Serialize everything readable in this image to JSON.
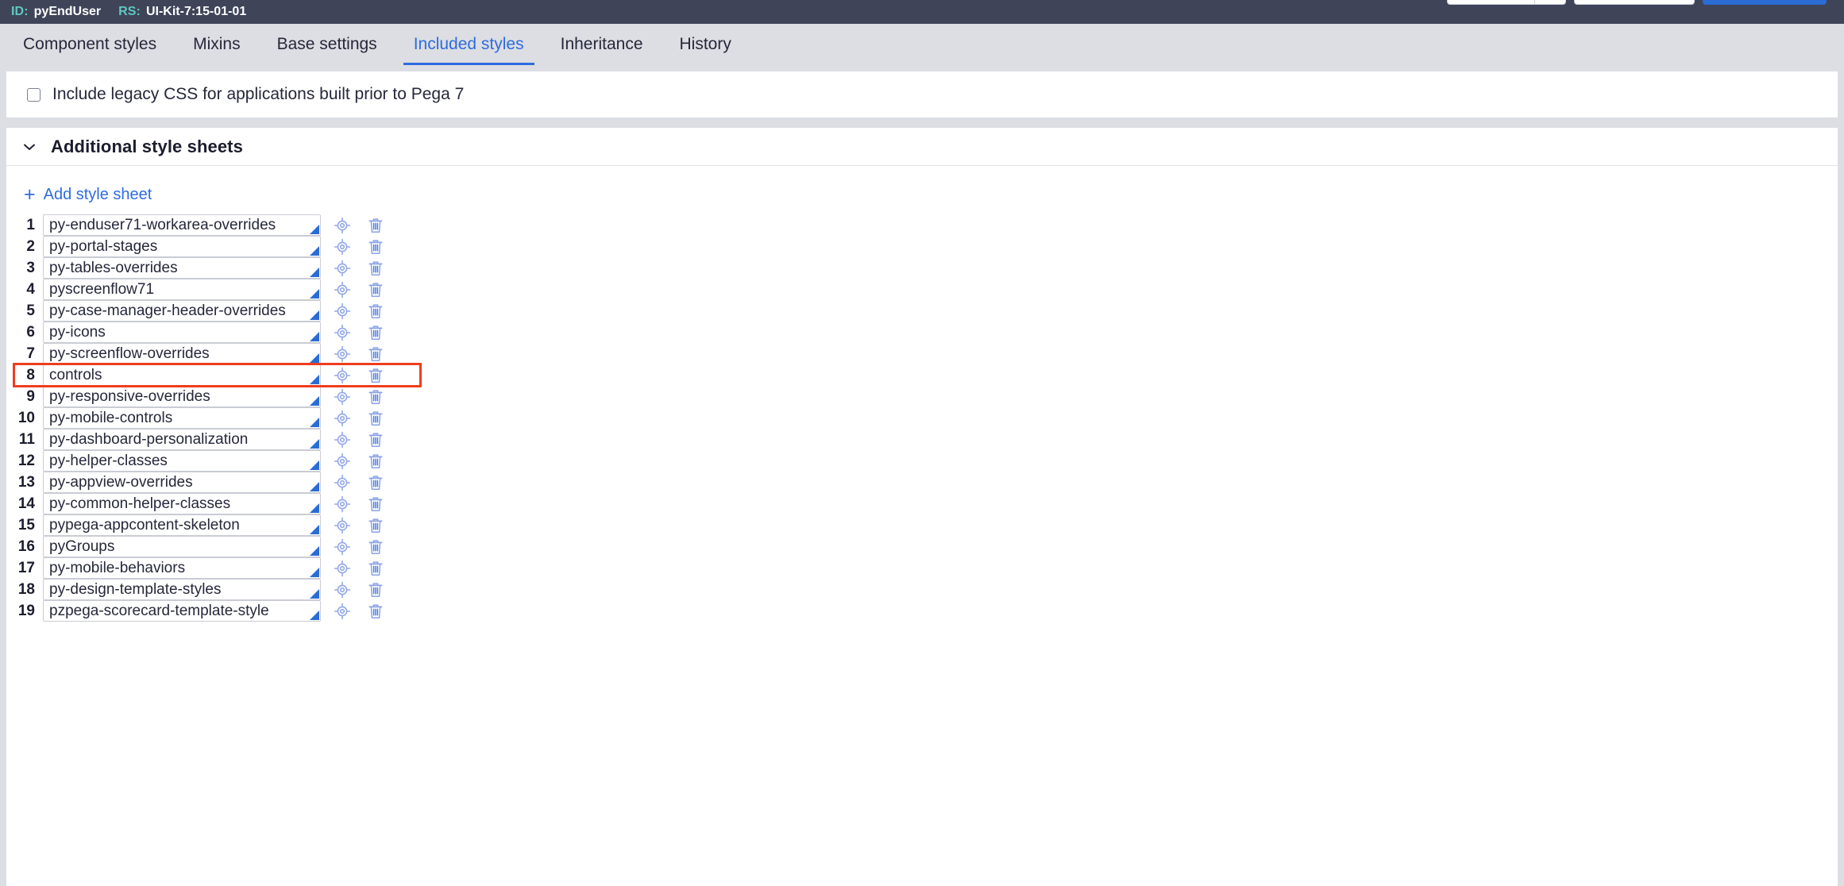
{
  "topbar": {
    "id_label": "ID:",
    "id_value": "pyEndUser",
    "rs_label": "RS:",
    "rs_value": "UI-Kit-7:15-01-01",
    "buttons": [
      {
        "name": "save-split-button",
        "label": ""
      },
      {
        "name": "secondary-action-button",
        "label": ""
      },
      {
        "name": "primary-action-button",
        "label": ""
      }
    ]
  },
  "tabs": [
    {
      "label": "Component styles",
      "active": false
    },
    {
      "label": "Mixins",
      "active": false
    },
    {
      "label": "Base settings",
      "active": false
    },
    {
      "label": "Included styles",
      "active": true
    },
    {
      "label": "Inheritance",
      "active": false
    },
    {
      "label": "History",
      "active": false
    }
  ],
  "legacy": {
    "checked": false,
    "label": "Include legacy CSS for applications built prior to Pega 7"
  },
  "sheets_section": {
    "title": "Additional style sheets",
    "collapse_icon": "chevron-down-icon",
    "add_label": "Add style sheet",
    "add_icon": "plus-icon",
    "row_icons": {
      "locate": "crosshair-icon",
      "delete": "trash-icon"
    },
    "grip_icon": "resize-grip-icon"
  },
  "style_sheets": [
    {
      "index": "1",
      "name": "py-enduser71-workarea-overrides"
    },
    {
      "index": "2",
      "name": "py-portal-stages"
    },
    {
      "index": "3",
      "name": "py-tables-overrides"
    },
    {
      "index": "4",
      "name": "pyscreenflow71"
    },
    {
      "index": "5",
      "name": "py-case-manager-header-overrides"
    },
    {
      "index": "6",
      "name": "py-icons"
    },
    {
      "index": "7",
      "name": "py-screenflow-overrides"
    },
    {
      "index": "8",
      "name": "controls"
    },
    {
      "index": "9",
      "name": "py-responsive-overrides"
    },
    {
      "index": "10",
      "name": "py-mobile-controls"
    },
    {
      "index": "11",
      "name": "py-dashboard-personalization"
    },
    {
      "index": "12",
      "name": "py-helper-classes"
    },
    {
      "index": "13",
      "name": "py-appview-overrides"
    },
    {
      "index": "14",
      "name": "py-common-helper-classes"
    },
    {
      "index": "15",
      "name": "pypega-appcontent-skeleton"
    },
    {
      "index": "16",
      "name": "pyGroups"
    },
    {
      "index": "17",
      "name": "py-mobile-behaviors"
    },
    {
      "index": "18",
      "name": "py-design-template-styles"
    },
    {
      "index": "19",
      "name": "pzpega-scorecard-template-style"
    }
  ],
  "highlight": {
    "row_index": 8,
    "color": "#ef3d1e"
  },
  "colors": {
    "topbar_bg": "#3f4459",
    "accent_teal": "#5ec9c2",
    "tab_bg": "#dcdee3",
    "link_blue": "#2f6bdf",
    "icon_blue": "#92a9e8",
    "grip_blue": "#2b6cd4",
    "text_dark": "#26283b"
  }
}
